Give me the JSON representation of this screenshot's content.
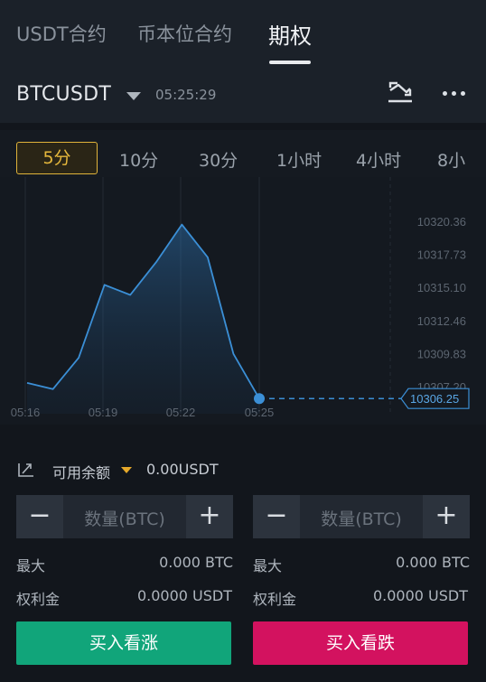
{
  "tabs": [
    {
      "label": "USDT合约",
      "active": false
    },
    {
      "label": "币本位合约",
      "active": false
    },
    {
      "label": "期权",
      "active": true
    }
  ],
  "header": {
    "symbol": "BTCUSDT",
    "time": "05:25:29",
    "icons": [
      "swap-icon",
      "more-icon"
    ]
  },
  "intervals": [
    "5分",
    "10分",
    "30分",
    "1小时",
    "4小时",
    "8小"
  ],
  "selected_interval": "5分",
  "chart": {
    "y_labels": [
      "10320.36",
      "10317.73",
      "10315.10",
      "10312.46",
      "10309.83",
      "10307.20"
    ],
    "x_labels": [
      "05:16",
      "05:19",
      "05:22",
      "05:25"
    ],
    "current_price": "10306.25",
    "line_color": "#3b8fd6",
    "price_points": [
      10307.5,
      10307.0,
      10309.5,
      10315.3,
      10314.5,
      10317.1,
      10320.1,
      10317.5,
      10309.8,
      10306.25
    ]
  },
  "balance": {
    "label": "可用余额",
    "value": "0.00USDT"
  },
  "call": {
    "minus": "−",
    "plus": "+",
    "placeholder": "数量(BTC)",
    "max_label": "最大",
    "max_value": "0.000 BTC",
    "premium_label": "权利金",
    "premium_value": "0.0000 USDT",
    "button_label": "买入看涨",
    "color": "#11a57a"
  },
  "put": {
    "minus": "−",
    "plus": "+",
    "placeholder": "数量(BTC)",
    "max_label": "最大",
    "max_value": "0.000 BTC",
    "premium_label": "权利金",
    "premium_value": "0.0000 USDT",
    "button_label": "买入看跌",
    "color": "#d3125f"
  }
}
